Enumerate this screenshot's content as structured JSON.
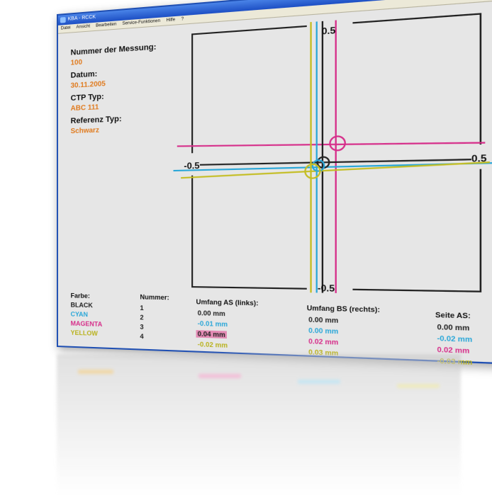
{
  "window": {
    "title": "KBA - RCCK",
    "menu": [
      "Datei",
      "Ansicht",
      "Bearbeiten",
      "Service-Funktionen",
      "Hilfe",
      "?"
    ],
    "buttons": {
      "minimize": "_",
      "maximize": "□",
      "close": "×"
    }
  },
  "info": {
    "measurement_label": "Nummer der Messung:",
    "measurement_value": "100",
    "date_label": "Datum:",
    "date_value": "30.11.2005",
    "ctp_label": "CTP Typ:",
    "ctp_value": "ABC 111",
    "ref_label": "Referenz Typ:",
    "ref_value": "Schwarz"
  },
  "table": {
    "headers": {
      "color": "Farbe:",
      "number": "Nummer:",
      "left": "Umfang AS (links):",
      "right": "Umfang BS (rechts):",
      "side": "Seite AS:"
    },
    "rows": [
      {
        "color": "BLACK",
        "number": "1",
        "left": "0.00 mm",
        "right": "0.00 mm",
        "side": "0.00 mm"
      },
      {
        "color": "CYAN",
        "number": "2",
        "left": "-0.01 mm",
        "right": "0.00 mm",
        "side": "-0.02 mm"
      },
      {
        "color": "MAGENTA",
        "number": "3",
        "left": "0.04 mm",
        "right": "0.02 mm",
        "side": "0.02 mm"
      },
      {
        "color": "YELLOW",
        "number": "4",
        "left": "-0.02 mm",
        "right": "0.03 mm",
        "side": "-0.03 mm"
      }
    ]
  },
  "plot": {
    "tick_top": "0.5",
    "tick_bottom": "-0.5",
    "tick_left": "-0.5",
    "tick_right": "0.5"
  },
  "colors": {
    "black": "#222222",
    "cyan": "#2aa7d8",
    "magenta": "#d62e8a",
    "yellow": "#c4bd22",
    "accent": "#e07b1f",
    "titlebar": "#1d4fc4"
  }
}
